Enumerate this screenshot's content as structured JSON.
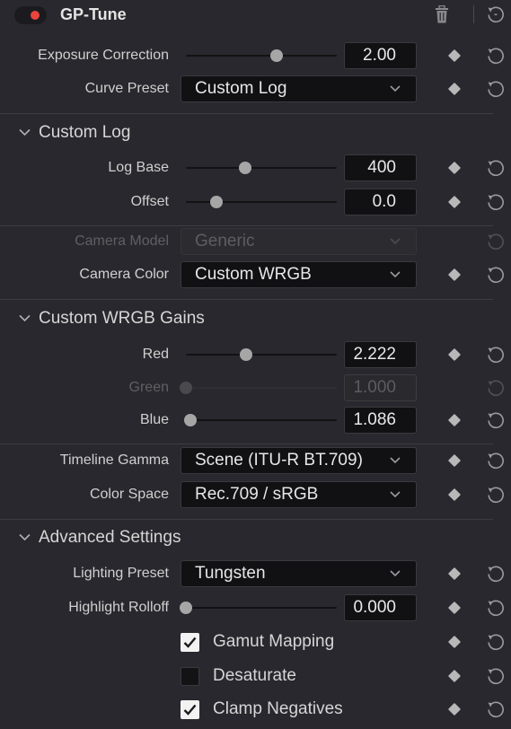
{
  "header": {
    "title": "GP-Tune",
    "enabled": true,
    "accent": "#e8453c"
  },
  "icons": {
    "keyframe": "diamond-keyframe-icon",
    "reset": "reset-icon",
    "dropdown": "chevron-down-icon",
    "section_toggle": "chevron-down-icon",
    "delete": "trash-icon"
  },
  "controls": {
    "exposure_correction": {
      "label": "Exposure Correction",
      "value": "2.00",
      "slider_fraction": 0.6
    },
    "curve_preset": {
      "label": "Curve Preset",
      "value": "Custom Log"
    }
  },
  "custom_log": {
    "title": "Custom Log",
    "log_base": {
      "label": "Log Base",
      "value": "400",
      "slider_fraction": 0.39
    },
    "offset": {
      "label": "Offset",
      "value": "0.0",
      "slider_fraction": 0.2
    }
  },
  "camera": {
    "model": {
      "label": "Camera Model",
      "value": "Generic",
      "disabled": true
    },
    "color": {
      "label": "Camera Color",
      "value": "Custom WRGB"
    }
  },
  "wrgb_gains": {
    "title": "Custom WRGB Gains",
    "red": {
      "label": "Red",
      "value": "2.222",
      "slider_fraction": 0.4
    },
    "green": {
      "label": "Green",
      "value": "1.000",
      "slider_fraction": 0.0,
      "disabled": true
    },
    "blue": {
      "label": "Blue",
      "value": "1.086",
      "slider_fraction": 0.03
    }
  },
  "output": {
    "timeline_gamma": {
      "label": "Timeline Gamma",
      "value": "Scene (ITU-R BT.709)"
    },
    "color_space": {
      "label": "Color Space",
      "value": "Rec.709 / sRGB"
    }
  },
  "advanced": {
    "title": "Advanced Settings",
    "lighting_preset": {
      "label": "Lighting Preset",
      "value": "Tungsten"
    },
    "highlight_rolloff": {
      "label": "Highlight Rolloff",
      "value": "0.000",
      "slider_fraction": 0.0
    },
    "gamut_mapping": {
      "label": "Gamut Mapping",
      "checked": true
    },
    "desaturate": {
      "label": "Desaturate",
      "checked": false
    },
    "clamp_negatives": {
      "label": "Clamp Negatives",
      "checked": true
    }
  }
}
